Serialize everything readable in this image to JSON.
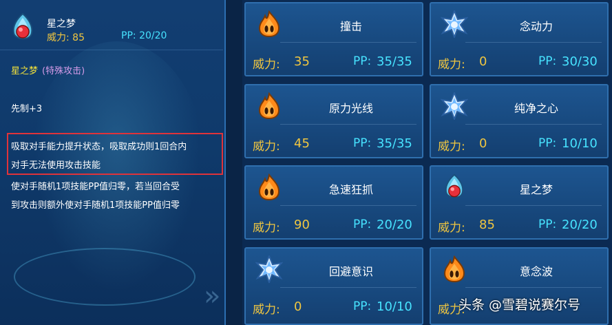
{
  "detail": {
    "name": "星之梦",
    "power_label": "威力",
    "power_value": "85",
    "pp_label": "PP",
    "pp_value": "20/20",
    "type_name": "星之梦",
    "type_category": "(特殊攻击)",
    "priority": "先制+3",
    "desc_highlight_lines": [
      "吸取对手能力提升状态，吸取成功则1回合内",
      "对手无法使用攻击技能"
    ],
    "desc_rest_lines": [
      "使对手随机1项技能PP值归零，若当回合受",
      "到攻击则额外使对手随机1项技能PP值归零"
    ],
    "icon": "star-dream-icon"
  },
  "skills": [
    {
      "name": "撞击",
      "power_label": "威力:",
      "power": "35",
      "pp_label": "PP:",
      "pp": "35/35",
      "icon": "fire-icon"
    },
    {
      "name": "念动力",
      "power_label": "威力:",
      "power": "0",
      "pp_label": "PP:",
      "pp": "30/30",
      "icon": "star-icon"
    },
    {
      "name": "原力光线",
      "power_label": "威力:",
      "power": "45",
      "pp_label": "PP:",
      "pp": "35/35",
      "icon": "fire-icon"
    },
    {
      "name": "纯净之心",
      "power_label": "威力:",
      "power": "0",
      "pp_label": "PP:",
      "pp": "10/10",
      "icon": "star-icon"
    },
    {
      "name": "急速狂抓",
      "power_label": "威力:",
      "power": "90",
      "pp_label": "PP:",
      "pp": "20/20",
      "icon": "fire-icon"
    },
    {
      "name": "星之梦",
      "power_label": "威力:",
      "power": "85",
      "pp_label": "PP:",
      "pp": "20/20",
      "icon": "star-dream-icon"
    },
    {
      "name": "回避意识",
      "power_label": "威力:",
      "power": "0",
      "pp_label": "PP:",
      "pp": "10/10",
      "icon": "star-icon"
    },
    {
      "name": "意念波",
      "power_label": "威力:",
      "power": "",
      "pp_label": "",
      "pp": "",
      "icon": "fire-icon"
    }
  ],
  "watermark": "头条 @雪碧说赛尔号",
  "colors": {
    "power": "#f0c640",
    "pp": "#47e3ff",
    "highlight_box": "#e0333a",
    "card_border": "#2f6fae"
  }
}
